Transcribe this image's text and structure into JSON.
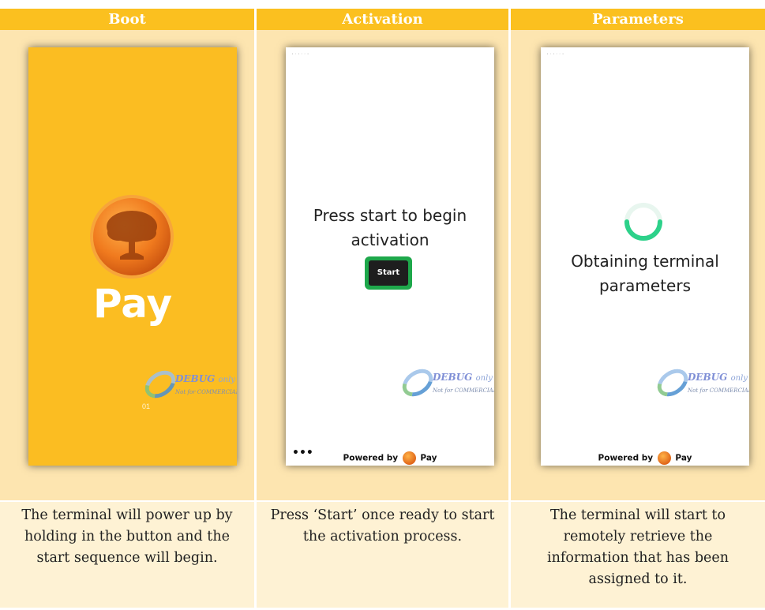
{
  "columns": [
    {
      "header": "Boot",
      "description": "The terminal will power up by holding in the button and the start sequence will begin.",
      "screen": {
        "brand_text": "Pay",
        "counter": "01",
        "watermark_title": "DEBUG",
        "watermark_suffix": "only",
        "watermark_sub": "Not for COMMERCIAL"
      }
    },
    {
      "header": "Activation",
      "description": "Press ‘Start’ once ready to start the activation process.",
      "screen": {
        "message": [
          "Press start to begin",
          "activation"
        ],
        "button_label": "Start",
        "watermark_title": "DEBUG",
        "watermark_suffix": "only",
        "watermark_sub": "Not for COMMERCIAL",
        "footer_prefix": "Powered by",
        "footer_brand": "Pay",
        "menu": "•••"
      }
    },
    {
      "header": "Parameters",
      "description": "The terminal will start to remotely retrieve the information that has been assigned to it.",
      "screen": {
        "message": [
          "Obtaining terminal",
          "parameters"
        ],
        "watermark_title": "DEBUG",
        "watermark_suffix": "only",
        "watermark_sub": "Not for COMMERCIAL",
        "footer_prefix": "Powered by",
        "footer_brand": "Pay"
      }
    }
  ],
  "colors": {
    "header_bg": "#fbc01f",
    "cell_bg": "#fde5b0",
    "description_bg": "#fef2d4",
    "boot_screen_bg": "#fbbd22",
    "start_button_border": "#1ea84b",
    "spinner": "#2dd18a"
  }
}
